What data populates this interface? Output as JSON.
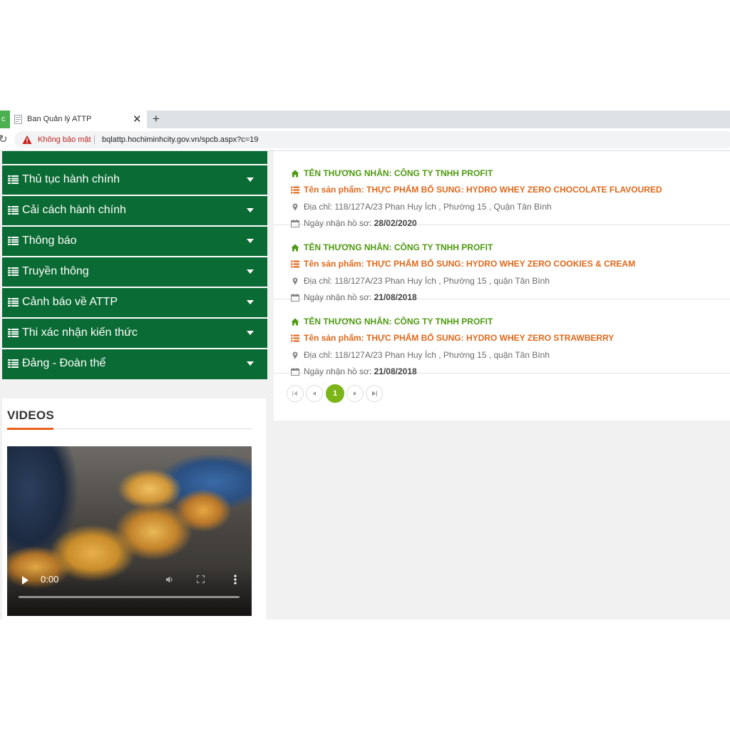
{
  "browser": {
    "tab_edge_label": "c",
    "tab_title": "Ban Quản lý ATTP",
    "tab_close": "✕",
    "new_tab": "+",
    "reload": "↻",
    "insecure_label": "Không bảo mật",
    "url": "bqlattp.hochiminhcity.gov.vn/spcb.aspx?c=19"
  },
  "sidebar": {
    "items": [
      {
        "label": "Thủ tục hành chính"
      },
      {
        "label": "Cải cách hành chính"
      },
      {
        "label": "Thông báo"
      },
      {
        "label": "Truyền thông"
      },
      {
        "label": "Cảnh báo về ATTP"
      },
      {
        "label": "Thi xác nhận kiến thức"
      },
      {
        "label": "Đảng - Đoàn thể"
      }
    ]
  },
  "videos": {
    "title": "VIDEOS",
    "time": "0:00",
    "progress": 0
  },
  "records": [
    {
      "merchant": "TÊN THƯƠNG NHÂN: CÔNG TY TNHH PROFIT",
      "product": "Tên sản phẩm: THỰC PHẨM BỔ SUNG: HYDRO WHEY ZERO CHOCOLATE FLAVOURED",
      "address": "Địa chỉ: 118/127A/23 Phan Huy Ích , Phường 15 , Quận Tân Bình",
      "date_label": "Ngày nhận hồ sơ:",
      "date": "28/02/2020"
    },
    {
      "merchant": "TÊN THƯƠNG NHÂN: CÔNG TY TNHH PROFIT",
      "product": "Tên sản phẩm: THỰC PHẨM BỔ SUNG: HYDRO WHEY ZERO COOKIES & CREAM",
      "address": "Địa chỉ: 118/127A/23 Phan Huy Ích , Phường 15 , quận Tân Bình",
      "date_label": "Ngày nhận hồ sơ:",
      "date": "21/08/2018"
    },
    {
      "merchant": "TÊN THƯƠNG NHÂN: CÔNG TY TNHH PROFIT",
      "product": "Tên sản phẩm: THỰC PHẨM BỔ SUNG: HYDRO WHEY ZERO STRAWBERRY",
      "address": "Địa chỉ: 118/127A/23 Phan Huy Ích , Phường 15 , quận Tân Bình",
      "date_label": "Ngày nhận hồ sơ:",
      "date": "21/08/2018"
    }
  ],
  "pagination": {
    "current_page": "1"
  },
  "colors": {
    "sidebar_bg": "#0b6b34",
    "merchant_green": "#4f9a12",
    "product_orange": "#e0691c",
    "accent_orange": "#e8611b",
    "pager_active": "#7cb518",
    "warning_red": "#c5221f"
  },
  "icons": {
    "merchant": "home-icon",
    "product": "list-icon",
    "address": "map-marker-icon",
    "date": "calendar-icon",
    "menu": "menu-list-icon",
    "menu_expand": "caret-down-icon"
  }
}
